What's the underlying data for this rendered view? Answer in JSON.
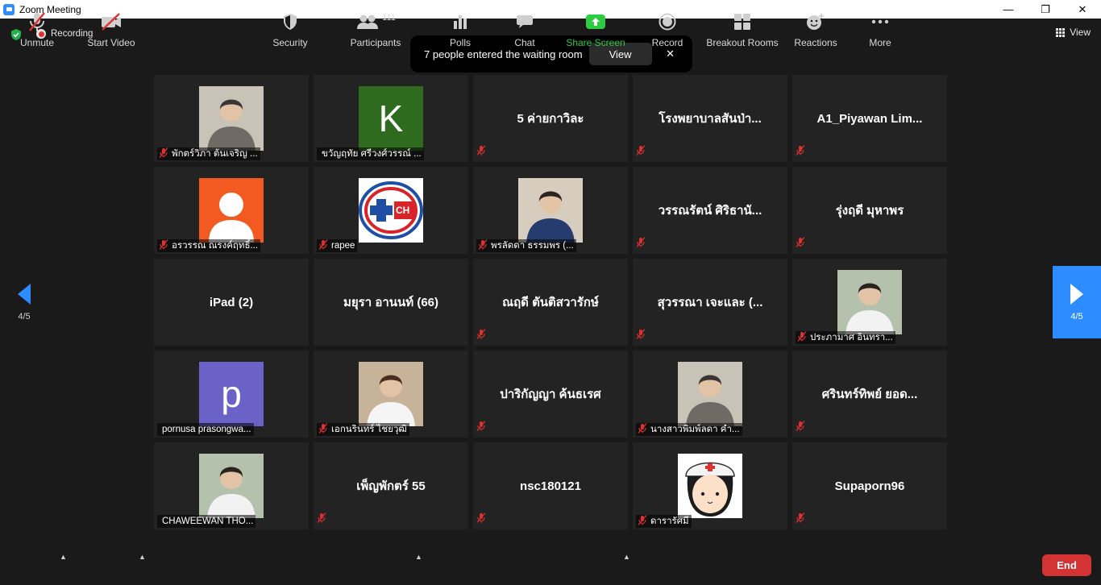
{
  "window": {
    "title": "Zoom Meeting",
    "controls": [
      "—",
      "❐",
      "✕"
    ]
  },
  "top": {
    "recording_label": "Recording",
    "view_label": "View"
  },
  "notification": {
    "message": "7 people entered the waiting room",
    "view_button": "View",
    "close": "✕"
  },
  "nav": {
    "left_page": "4/5",
    "right_page": "4/5"
  },
  "tiles": [
    {
      "name": "",
      "label": "พักตร์วิภา ต้นเจริญ ...",
      "kind": "photo",
      "muted": true
    },
    {
      "name": "",
      "label": "ขวัญฤทัย ศรีวงศ์วรรณ์ ...",
      "kind": "letter",
      "letter": "K",
      "bg": "#2f6b1e",
      "muted": false
    },
    {
      "name": "5 ค่ายกาวิละ",
      "label": "",
      "kind": "name",
      "muted": true
    },
    {
      "name": "โรงพยาบาลสันป่า...",
      "label": "",
      "kind": "name",
      "muted": true
    },
    {
      "name": "A1_Piyawan  Lim...",
      "label": "",
      "kind": "name",
      "muted": true
    },
    {
      "name": "",
      "label": "อรวรรณ ณรงค์ฤทธิ์...",
      "kind": "person",
      "bg": "#f25a22",
      "muted": true
    },
    {
      "name": "",
      "label": "rapee",
      "kind": "logo",
      "muted": true
    },
    {
      "name": "",
      "label": "พรลัดดา ธรรมพร (...",
      "kind": "photo",
      "muted": true
    },
    {
      "name": "วรรณรัตน์ ศิริธานั...",
      "label": "",
      "kind": "name",
      "muted": true
    },
    {
      "name": "รุ่งฤดี มุหาพร",
      "label": "",
      "kind": "name",
      "muted": true
    },
    {
      "name": "iPad (2)",
      "label": "",
      "kind": "name",
      "muted": false
    },
    {
      "name": "มยุรา อานนท์ (66)",
      "label": "",
      "kind": "name",
      "muted": false
    },
    {
      "name": "ณฤดี ตันติสวารักษ์",
      "label": "",
      "kind": "name",
      "muted": true
    },
    {
      "name": "สุวรรณา เจะและ (...",
      "label": "",
      "kind": "name",
      "muted": true
    },
    {
      "name": "",
      "label": "ประภามาศ  อินทรา...",
      "kind": "photo",
      "muted": true
    },
    {
      "name": "",
      "label": "pornusa prasongwa...",
      "kind": "letter",
      "letter": "p",
      "bg": "#6b62c8",
      "muted": false
    },
    {
      "name": "",
      "label": "เอกนรินทร์ ไชยวุฒิ",
      "kind": "photo",
      "muted": true
    },
    {
      "name": "ปาริกัญญา  ค้นธเรศ",
      "label": "",
      "kind": "name",
      "muted": true
    },
    {
      "name": "",
      "label": "นางสาวพิมพ์ลดา คำ...",
      "kind": "photo",
      "muted": true
    },
    {
      "name": "ศรินทร์ทิพย์ ยอด...",
      "label": "",
      "kind": "name",
      "muted": true
    },
    {
      "name": "",
      "label": "CHAWEEWAN THO...",
      "kind": "photo",
      "muted": false
    },
    {
      "name": "เพ็ญพักตร์ 55",
      "label": "",
      "kind": "name",
      "muted": true
    },
    {
      "name": "nsc180121",
      "label": "",
      "kind": "name",
      "muted": true
    },
    {
      "name": "",
      "label": "ดารารัศมี",
      "kind": "cartoon",
      "muted": true
    },
    {
      "name": "Supaporn96",
      "label": "",
      "kind": "name",
      "muted": true
    }
  ],
  "logo_text": "CH",
  "toolbar": {
    "unmute": "Unmute",
    "start_video": "Start Video",
    "security": "Security",
    "participants": "Participants",
    "participants_count": "111",
    "polls": "Polls",
    "chat": "Chat",
    "share_screen": "Share Screen",
    "record": "Record",
    "breakout_rooms": "Breakout Rooms",
    "reactions": "Reactions",
    "more": "More",
    "end": "End"
  },
  "colors": {
    "accent_blue": "#2d8cff",
    "share_green": "#2ecc40",
    "end_red": "#d33333",
    "tile_bg": "#232323",
    "muted_red": "#e02f2f"
  }
}
